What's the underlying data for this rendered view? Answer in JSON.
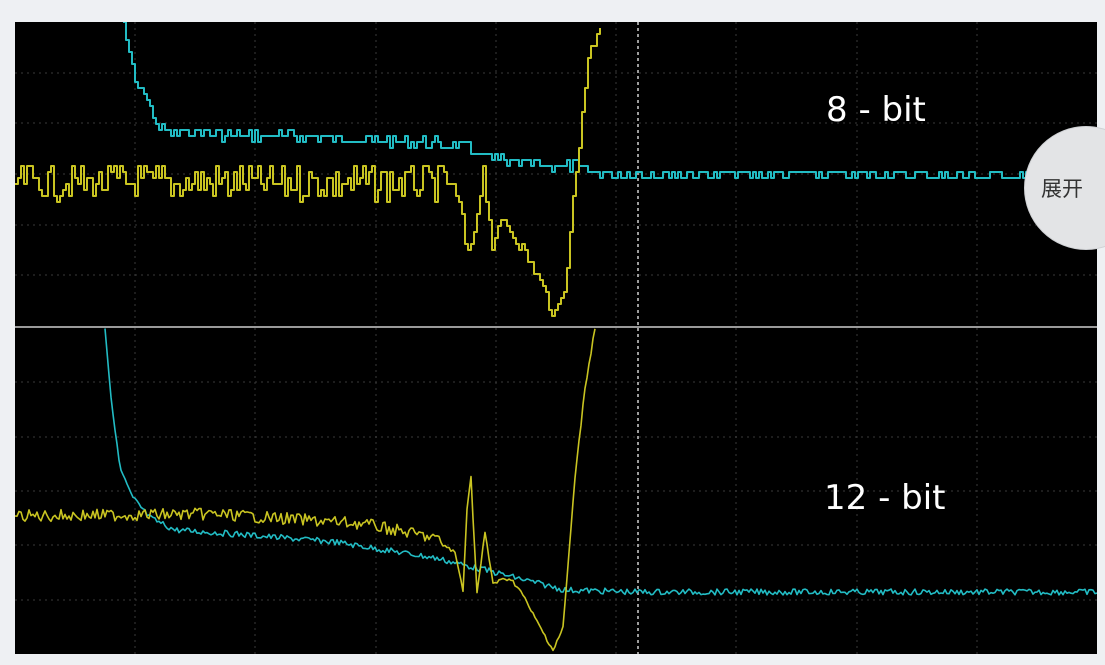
{
  "labels": {
    "top": "8 - bit",
    "bottom": "12 - bit"
  },
  "expand_button": {
    "label": "展开"
  },
  "colors": {
    "background": "#000000",
    "grid": "#3a3a3a",
    "cursor": "#cfcfcf",
    "cyan_trace": "#22bcc4",
    "yellow_trace": "#c9c421",
    "divider": "#9a9a9a"
  }
}
